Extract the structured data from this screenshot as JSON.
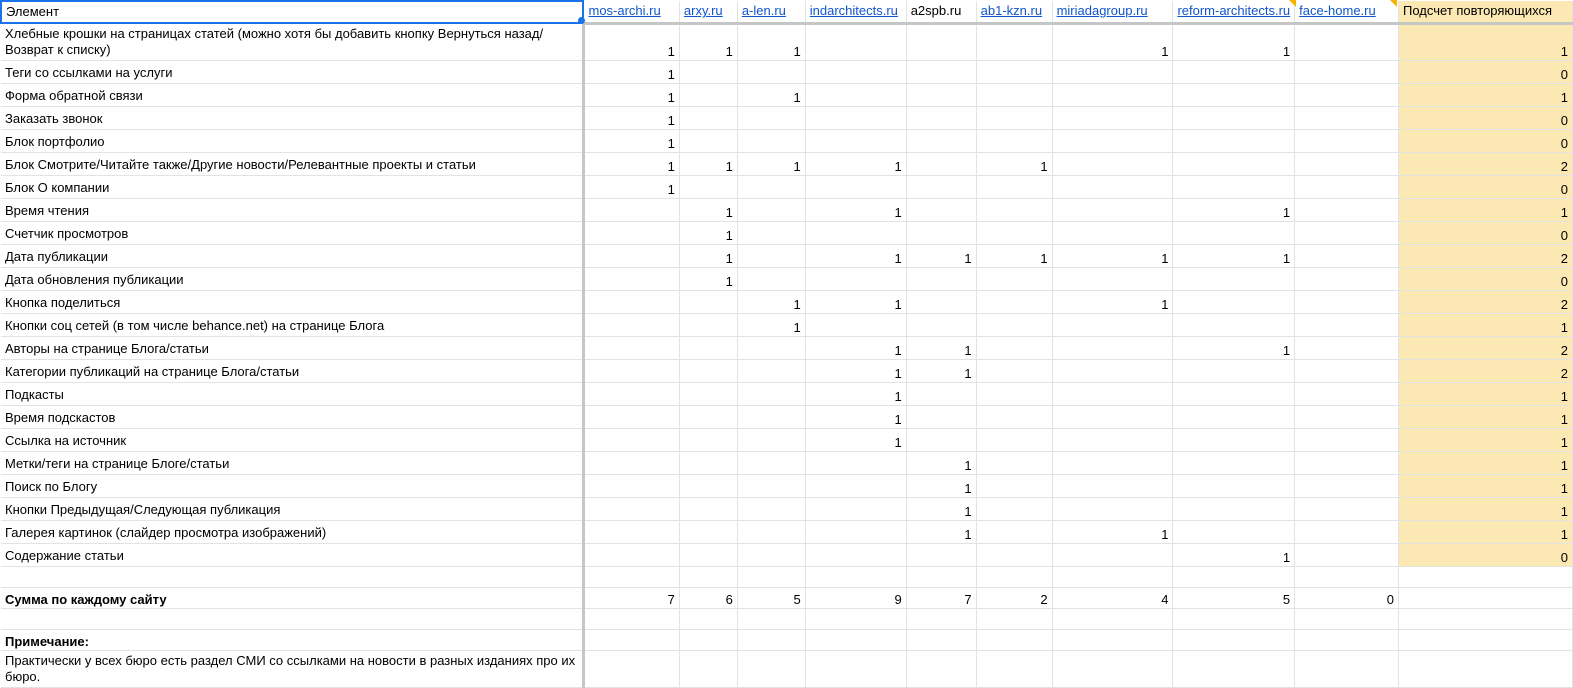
{
  "header": {
    "element_label": "Элемент",
    "sites": [
      "mos-archi.ru",
      "arxy.ru",
      "a-len.ru",
      "indarchitects.ru",
      "a2spb.ru",
      "ab1-kzn.ru",
      "miriadagroup.ru",
      "reform-architects.ru",
      "face-home.ru"
    ],
    "site_is_link": [
      true,
      true,
      true,
      true,
      false,
      true,
      true,
      true,
      true
    ],
    "count_label": "Подсчет повторяющихся"
  },
  "rows": [
    {
      "name": "Хлебные крошки на страницах статей (можно хотя бы добавить кнопку Вернуться назад/Возврат к списку)",
      "values": [
        "1",
        "1",
        "1",
        "",
        "",
        "",
        "1",
        "1",
        ""
      ],
      "count": "1"
    },
    {
      "name": "Теги со ссылками на услуги",
      "values": [
        "1",
        "",
        "",
        "",
        "",
        "",
        "",
        "",
        ""
      ],
      "count": "0"
    },
    {
      "name": "Форма обратной связи",
      "values": [
        "1",
        "",
        "1",
        "",
        "",
        "",
        "",
        "",
        ""
      ],
      "count": "1"
    },
    {
      "name": "Заказать звонок",
      "values": [
        "1",
        "",
        "",
        "",
        "",
        "",
        "",
        "",
        ""
      ],
      "count": "0"
    },
    {
      "name": "Блок портфолио",
      "values": [
        "1",
        "",
        "",
        "",
        "",
        "",
        "",
        "",
        ""
      ],
      "count": "0"
    },
    {
      "name": "Блок Смотрите/Читайте также/Другие новости/Релевантные проекты и статьи",
      "values": [
        "1",
        "1",
        "1",
        "1",
        "",
        "1",
        "",
        "",
        ""
      ],
      "count": "2"
    },
    {
      "name": "Блок О компании",
      "values": [
        "1",
        "",
        "",
        "",
        "",
        "",
        "",
        "",
        ""
      ],
      "count": "0"
    },
    {
      "name": "Время чтения",
      "values": [
        "",
        "1",
        "",
        "1",
        "",
        "",
        "",
        "1",
        ""
      ],
      "count": "1"
    },
    {
      "name": "Счетчик просмотров",
      "values": [
        "",
        "1",
        "",
        "",
        "",
        "",
        "",
        "",
        ""
      ],
      "count": "0"
    },
    {
      "name": "Дата публикации",
      "values": [
        "",
        "1",
        "",
        "1",
        "1",
        "1",
        "1",
        "1",
        ""
      ],
      "count": "2"
    },
    {
      "name": "Дата обновления публикации",
      "values": [
        "",
        "1",
        "",
        "",
        "",
        "",
        "",
        "",
        ""
      ],
      "count": "0"
    },
    {
      "name": "Кнопка поделиться",
      "values": [
        "",
        "",
        "1",
        "1",
        "",
        "",
        "1",
        "",
        ""
      ],
      "count": "2"
    },
    {
      "name": "Кнопки соц сетей (в том числе behance.net) на странице Блога",
      "values": [
        "",
        "",
        "1",
        "",
        "",
        "",
        "",
        "",
        ""
      ],
      "count": "1"
    },
    {
      "name": "Авторы на странице Блога/статьи",
      "values": [
        "",
        "",
        "",
        "1",
        "1",
        "",
        "",
        "1",
        ""
      ],
      "count": "2"
    },
    {
      "name": "Категории публикаций на странице Блога/статьи",
      "values": [
        "",
        "",
        "",
        "1",
        "1",
        "",
        "",
        "",
        ""
      ],
      "count": "2"
    },
    {
      "name": "Подкасты",
      "values": [
        "",
        "",
        "",
        "1",
        "",
        "",
        "",
        "",
        ""
      ],
      "count": "1"
    },
    {
      "name": "Время подскастов",
      "values": [
        "",
        "",
        "",
        "1",
        "",
        "",
        "",
        "",
        ""
      ],
      "count": "1"
    },
    {
      "name": "Ссылка на источник",
      "values": [
        "",
        "",
        "",
        "1",
        "",
        "",
        "",
        "",
        ""
      ],
      "count": "1"
    },
    {
      "name": "Метки/теги на странице Блоге/статьи",
      "values": [
        "",
        "",
        "",
        "",
        "1",
        "",
        "",
        "",
        ""
      ],
      "count": "1"
    },
    {
      "name": "Поиск по Блогу",
      "values": [
        "",
        "",
        "",
        "",
        "1",
        "",
        "",
        "",
        ""
      ],
      "count": "1"
    },
    {
      "name": "Кнопки Предыдущая/Следующая публикация",
      "values": [
        "",
        "",
        "",
        "",
        "1",
        "",
        "",
        "",
        ""
      ],
      "count": "1"
    },
    {
      "name": "Галерея картинок (слайдер просмотра изображений)",
      "values": [
        "",
        "",
        "",
        "",
        "1",
        "",
        "1",
        "",
        ""
      ],
      "count": "1"
    },
    {
      "name": "Содержание статьи",
      "values": [
        "",
        "",
        "",
        "",
        "",
        "",
        "",
        "1",
        ""
      ],
      "count": "0"
    }
  ],
  "sum_row": {
    "label": "Сумма по каждому сайту",
    "values": [
      "7",
      "6",
      "5",
      "9",
      "7",
      "2",
      "4",
      "5",
      "0"
    ]
  },
  "note": {
    "title": "Примечание:",
    "text": "Практически у всех бюро есть раздел СМИ со ссылками на новости в разных изданиях про их бюро."
  }
}
